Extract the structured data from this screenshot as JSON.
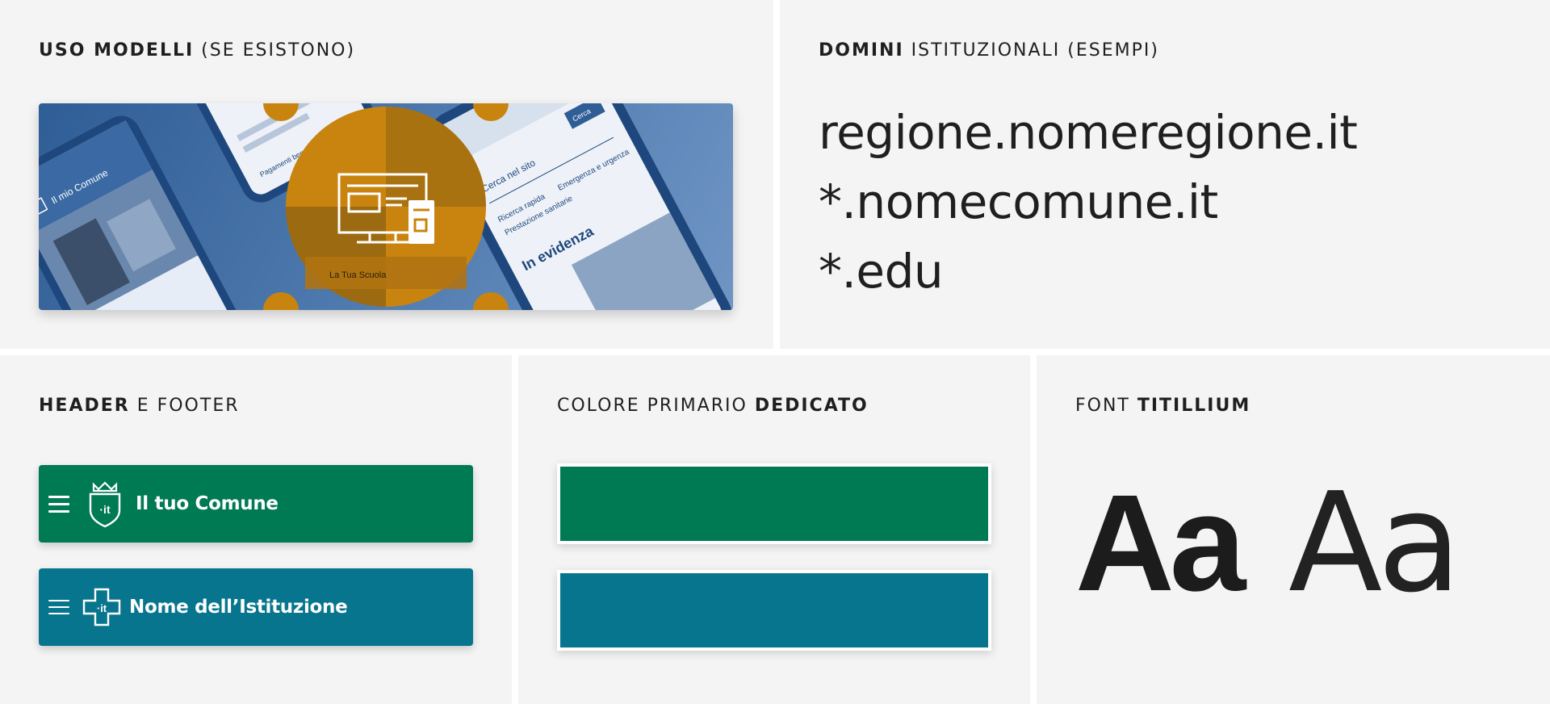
{
  "models_panel": {
    "title_bold": "USO MODELLI",
    "title_rest": " (SE ESISTONO)",
    "mockup_texts": {
      "phone_left_title": "Il mio Comune",
      "phone_mid_label": "Pagamenti beneficiari",
      "phone_right_search": "Cerca nel sito",
      "phone_right_button": "Cerca",
      "phone_right_link1": "Ricerca rapida",
      "phone_right_link2": "Emergenza e urgenza",
      "phone_right_link3": "Prestazione sanitarie",
      "phone_right_heading": "In evidenza",
      "phone_bottom_text": "La Tua Scuola"
    }
  },
  "domains_panel": {
    "title_bold": "DOMINI",
    "title_rest": " ISTITUZIONALI (ESEMPI)",
    "domains": [
      "regione.nomeregione.it",
      "*.nomecomune.it",
      "*.edu"
    ]
  },
  "header_panel": {
    "title_bold": "HEADER",
    "title_rest": " E FOOTER",
    "headers": [
      {
        "label": "Il tuo Comune",
        "color": "#007a52",
        "logo_text": "·it"
      },
      {
        "label": "Nome dell’Istituzione",
        "color": "#08758e",
        "logo_text": "·it"
      }
    ]
  },
  "color_panel": {
    "title_rest": "COLORE PRIMARIO ",
    "title_bold": "DEDICATO",
    "swatches": [
      "#007a52",
      "#08758e"
    ]
  },
  "font_panel": {
    "title_rest": "FONT ",
    "title_bold": "TITILLIUM",
    "sample_bold": "Aa",
    "sample_light": "Aa"
  },
  "colors": {
    "panel_bg": "#f4f4f4",
    "accent_orange": "#c8840f",
    "mockup_blue": "#2f5d95"
  }
}
